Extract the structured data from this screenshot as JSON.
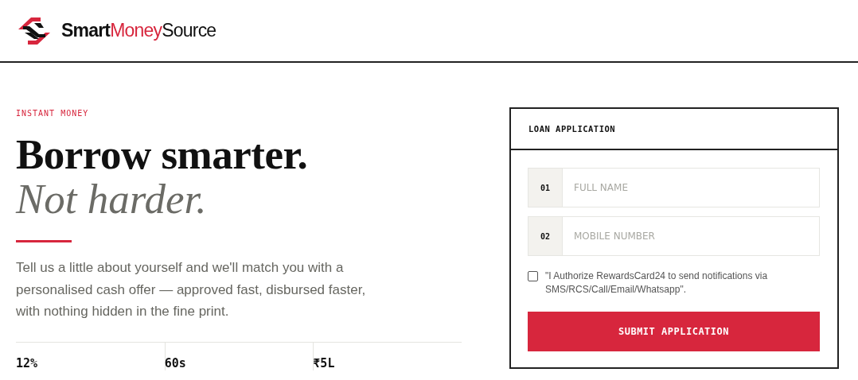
{
  "brand": {
    "parts": [
      {
        "text": "Smart",
        "kind": "strong"
      },
      {
        "text": "Money",
        "kind": "accent"
      },
      {
        "text": "Source",
        "kind": "plain"
      }
    ]
  },
  "hero": {
    "eyebrow": "INSTANT MONEY",
    "title": "Borrow smarter.",
    "subtitle": "Not harder.",
    "description": "Tell us a little about yourself and we'll match you with a personalised cash offer — approved fast, disbursed faster, with nothing hidden in the fine print."
  },
  "stats": [
    {
      "value": "12%"
    },
    {
      "value": "60s"
    },
    {
      "value": "₹5L"
    }
  ],
  "form": {
    "title": "LOAN APPLICATION",
    "fields": [
      {
        "number": "01",
        "placeholder": "FULL NAME"
      },
      {
        "number": "02",
        "placeholder": "MOBILE NUMBER"
      }
    ],
    "consent": {
      "checked": false,
      "text": "\"I Authorize RewardsCard24 to send notifications via SMS/RCS/Call/Email/Whatsapp\"."
    },
    "submit": "SUBMIT APPLICATION"
  }
}
